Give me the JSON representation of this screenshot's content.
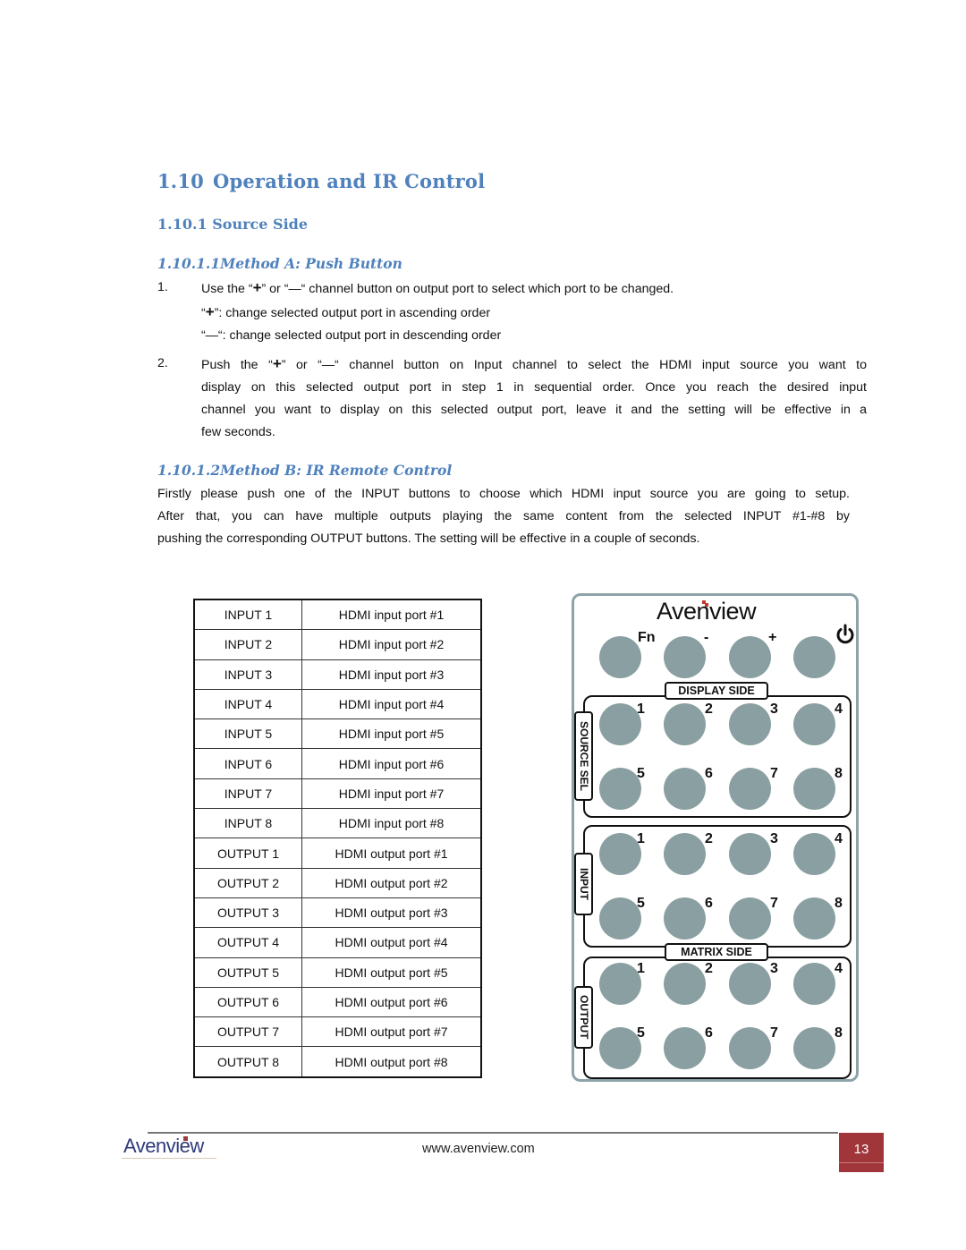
{
  "section": {
    "number": "1.10",
    "title": "Operation and IR Control"
  },
  "subsection": {
    "label": "1.10.1 Source Side"
  },
  "method_a": {
    "heading": "1.10.1.1Method A: Push Button",
    "items": [
      {
        "num": "1.",
        "lines": [
          {
            "pre": "Use the “",
            "sym1": "+",
            "mid": "” or “",
            "sym2": "—",
            "post": "“ channel button on output port to select which port to be changed."
          },
          {
            "pre": "“",
            "sym1": "+",
            "post": "”: change selected output port in ascending order"
          },
          {
            "pre": "“—“: change selected output port in descending order"
          }
        ]
      },
      {
        "num": "2.",
        "line1": {
          "pre": "Push the “",
          "sym1": "+",
          "mid": "” or “",
          "sym2": "—",
          "post": "“ channel button on Input channel to select the HDMI input source you want to"
        },
        "line2": "display on this selected output port in step 1 in sequential order. Once you reach the desired input",
        "line3": "channel you want to display on this selected output port, leave it and the setting will be effective in a",
        "line4": "few seconds."
      }
    ]
  },
  "method_b": {
    "heading": "1.10.1.2Method B: IR Remote Control",
    "lines": [
      "Firstly please push one of the INPUT buttons to choose which HDMI input source you are going to setup.",
      "After that, you can have multiple outputs playing the same content from the selected INPUT #1-#8 by",
      "pushing the corresponding OUTPUT buttons. The setting will be effective in a couple of seconds."
    ]
  },
  "port_table": {
    "rows": [
      [
        "INPUT 1",
        "HDMI input port #1"
      ],
      [
        "INPUT 2",
        "HDMI input port #2"
      ],
      [
        "INPUT 3",
        "HDMI input port #3"
      ],
      [
        "INPUT 4",
        "HDMI input port #4"
      ],
      [
        "INPUT 5",
        "HDMI input port #5"
      ],
      [
        "INPUT 6",
        "HDMI input port #6"
      ],
      [
        "INPUT 7",
        "HDMI input port #7"
      ],
      [
        "INPUT 8",
        "HDMI input port #8"
      ],
      [
        "OUTPUT 1",
        "HDMI output port #1"
      ],
      [
        "OUTPUT 2",
        "HDMI output port #2"
      ],
      [
        "OUTPUT 3",
        "HDMI output port #3"
      ],
      [
        "OUTPUT 4",
        "HDMI output port #4"
      ],
      [
        "OUTPUT 5",
        "HDMI output port #5"
      ],
      [
        "OUTPUT 6",
        "HDMI output port #6"
      ],
      [
        "OUTPUT 7",
        "HDMI output port #7"
      ],
      [
        "OUTPUT 8",
        "HDMI output port #8"
      ]
    ]
  },
  "remote": {
    "brand": "Avenview",
    "top_buttons": [
      {
        "label": "Fn",
        "icon": ""
      },
      {
        "label": "-",
        "icon": ""
      },
      {
        "label": "+",
        "icon": ""
      },
      {
        "label": "",
        "icon": "power-icon"
      }
    ],
    "display_side_label": "DISPLAY SIDE",
    "matrix_side_label": "MATRIX SIDE",
    "groups": [
      {
        "name": "SOURCE SEL",
        "buttons": [
          "1",
          "2",
          "3",
          "4",
          "5",
          "6",
          "7",
          "8"
        ]
      },
      {
        "name": "INPUT",
        "buttons": [
          "1",
          "2",
          "3",
          "4",
          "5",
          "6",
          "7",
          "8"
        ]
      },
      {
        "name": "OUTPUT",
        "buttons": [
          "1",
          "2",
          "3",
          "4",
          "5",
          "6",
          "7",
          "8"
        ]
      }
    ],
    "button_color": "#8a9fa1"
  },
  "footer": {
    "brand": "Avenview",
    "url": "www.avenview.com",
    "page_number": "13",
    "page_box_color": "#a0363a"
  }
}
